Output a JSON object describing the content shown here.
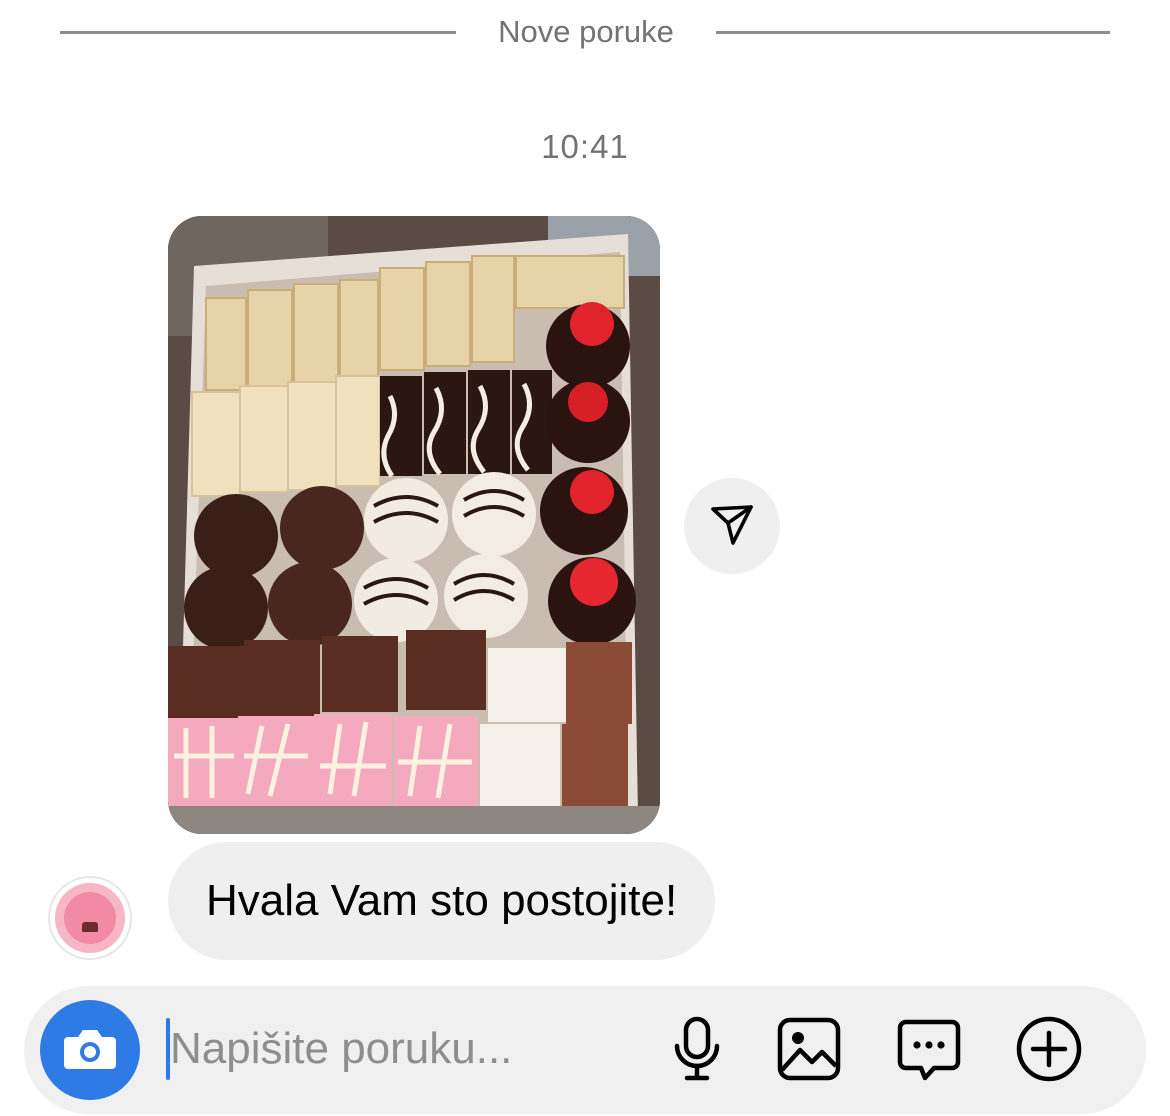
{
  "divider": {
    "label": "Nove poruke"
  },
  "timestamp": "10:41",
  "message": {
    "text": "Hvala Vam sto postojite!"
  },
  "composer": {
    "placeholder": "Napišite poruku..."
  },
  "colors": {
    "accent": "#2f7be5",
    "bubble": "#efefef",
    "muted": "#737373"
  },
  "icons": {
    "share": "paper-plane-icon",
    "camera": "camera-icon",
    "mic": "microphone-icon",
    "gallery": "image-icon",
    "sticker": "message-bubble-icon",
    "more": "plus-circle-icon"
  }
}
